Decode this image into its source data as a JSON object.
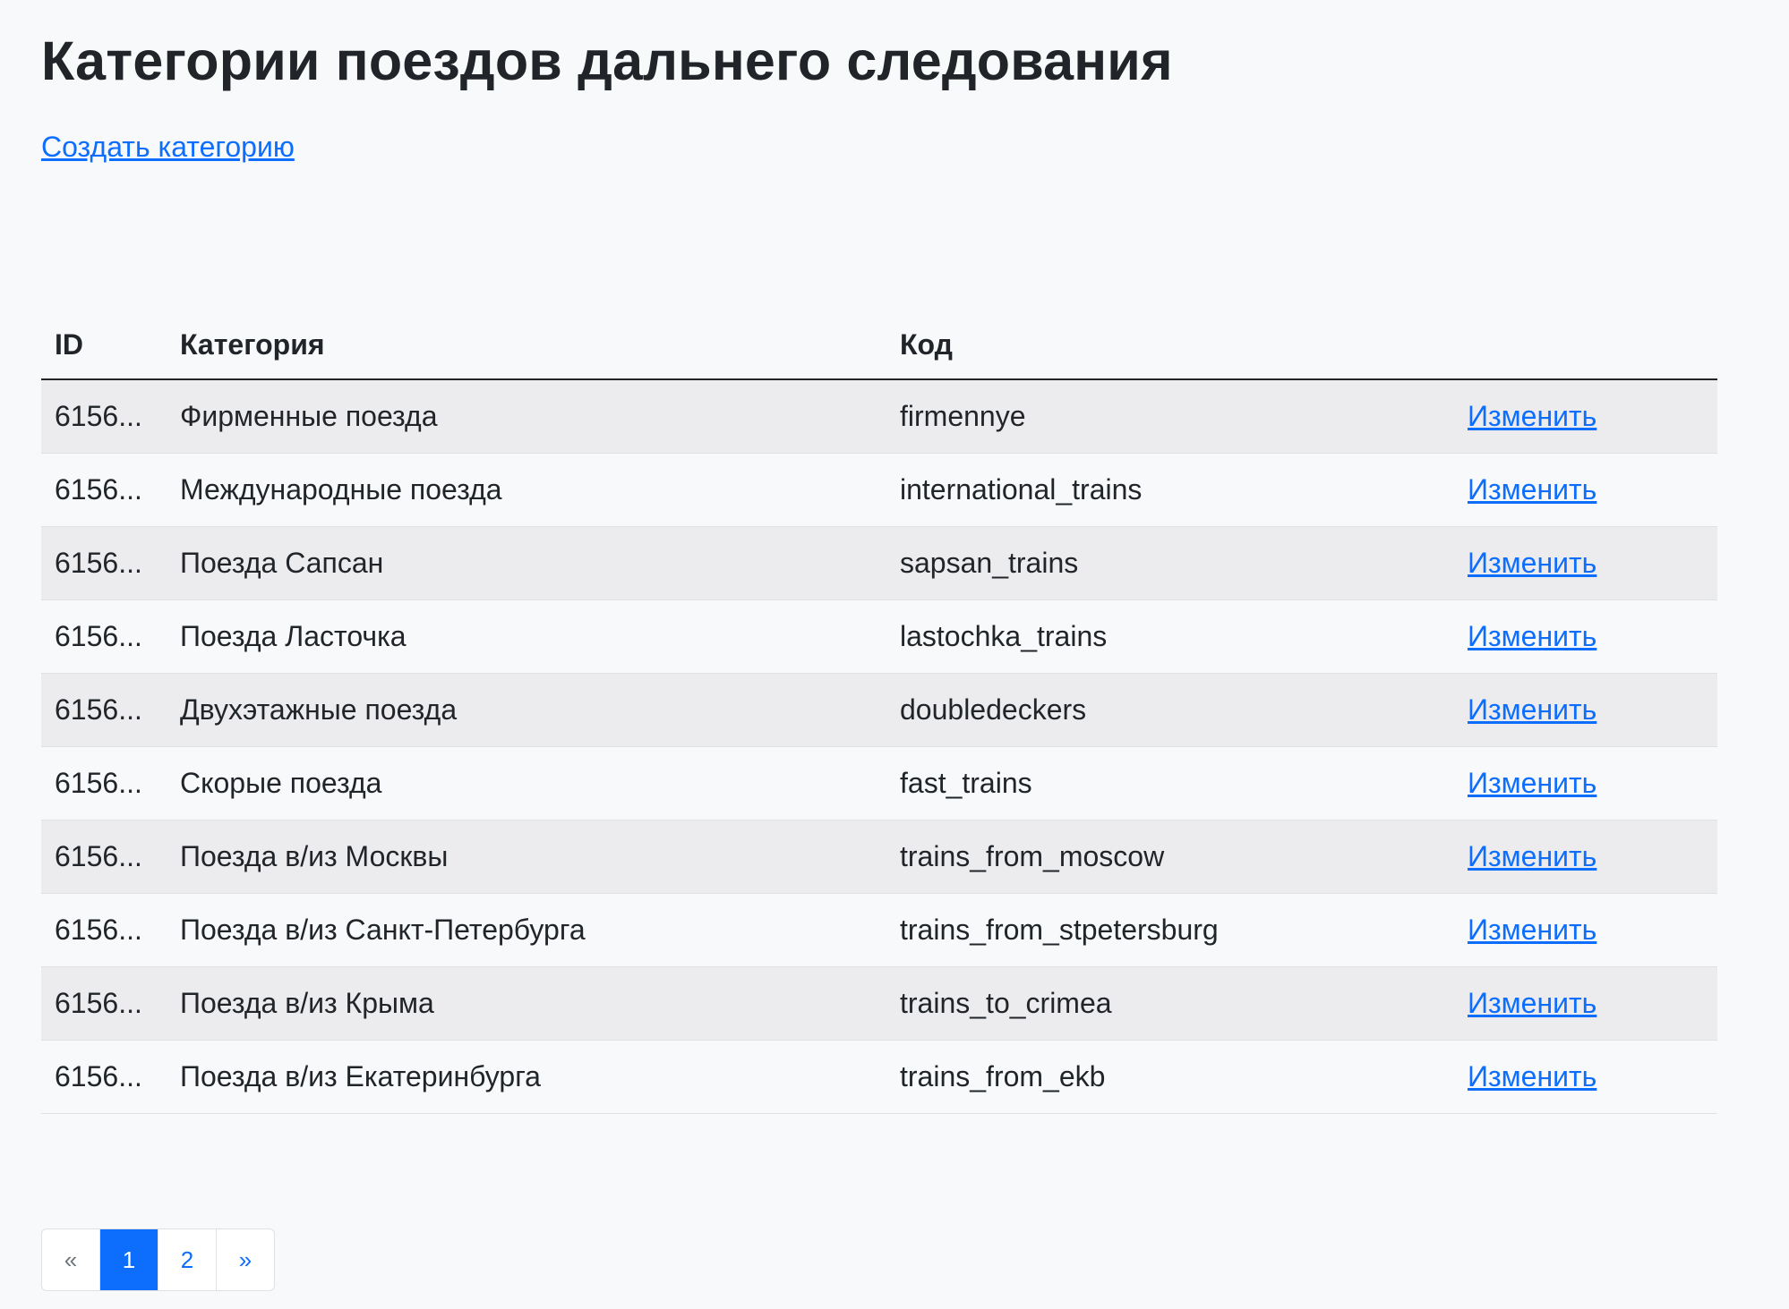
{
  "page": {
    "title": "Категории поездов дальнего следования",
    "create_link": "Создать категорию"
  },
  "table": {
    "headers": {
      "id": "ID",
      "category": "Категория",
      "code": "Код",
      "actions": ""
    },
    "rows": [
      {
        "id": "6156...",
        "category": "Фирменные поезда",
        "code": "firmennye",
        "action": "Изменить"
      },
      {
        "id": "6156...",
        "category": "Международные поезда",
        "code": "international_trains",
        "action": "Изменить"
      },
      {
        "id": "6156...",
        "category": "Поезда Сапсан",
        "code": "sapsan_trains",
        "action": "Изменить"
      },
      {
        "id": "6156...",
        "category": "Поезда Ласточка",
        "code": "lastochka_trains",
        "action": "Изменить"
      },
      {
        "id": "6156...",
        "category": "Двухэтажные поезда",
        "code": "doubledeckers",
        "action": "Изменить"
      },
      {
        "id": "6156...",
        "category": "Скорые поезда",
        "code": "fast_trains",
        "action": "Изменить"
      },
      {
        "id": "6156...",
        "category": "Поезда в/из Москвы",
        "code": "trains_from_moscow",
        "action": "Изменить"
      },
      {
        "id": "6156...",
        "category": "Поезда в/из Санкт-Петербурга",
        "code": "trains_from_stpetersburg",
        "action": "Изменить"
      },
      {
        "id": "6156...",
        "category": "Поезда в/из Крыма",
        "code": "trains_to_crimea",
        "action": "Изменить"
      },
      {
        "id": "6156...",
        "category": "Поезда в/из Екатеринбурга",
        "code": "trains_from_ekb",
        "action": "Изменить"
      }
    ]
  },
  "pagination": {
    "prev": "«",
    "pages": [
      "1",
      "2"
    ],
    "active_page": "1",
    "next": "»"
  },
  "colors": {
    "link": "#0d6efd",
    "active_page_bg": "#0d6efd",
    "striped_row": "#ececee",
    "background": "#f8f9fa"
  }
}
